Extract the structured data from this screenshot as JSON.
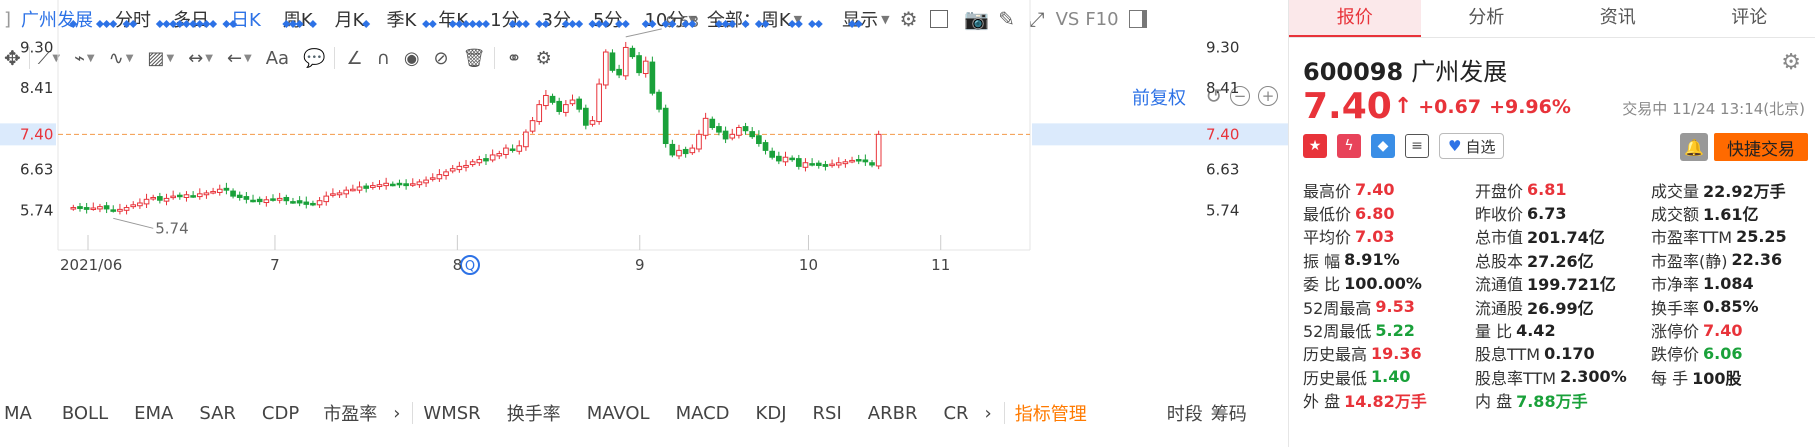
{
  "topbar": {
    "name": "广州发展",
    "periods": [
      "分时",
      "多日",
      "日K",
      "周K",
      "月K",
      "季K",
      "年K",
      "1分",
      "3分",
      "5分",
      "10分"
    ],
    "active_period": "日K",
    "range_select": "全部：周K",
    "display": "显示",
    "vs": "VS",
    "f10": "F10"
  },
  "toolbar2": {
    "text_tool": "Aa"
  },
  "chart": {
    "adjust_label": "前复权",
    "y_ticks": [
      "9.30",
      "8.41",
      "7.40",
      "6.63",
      "5.74"
    ],
    "x_ticks": [
      "2021/06",
      "7",
      "8",
      "9",
      "10",
      "11"
    ],
    "high_label": "9.53",
    "low_label": "5.74",
    "current_label": "7.40",
    "up_color": "#e8333a",
    "down_color": "#1aa13a",
    "marker_color": "#2d72e6",
    "event_icon": "Q"
  },
  "chart_data": {
    "type": "candlestick",
    "ylim": [
      5.2,
      9.9
    ],
    "current_price": 7.4,
    "period_high": 9.53,
    "period_low": 5.74,
    "x_tick_labels": [
      "2021/06",
      "7",
      "8",
      "9",
      "10",
      "11"
    ],
    "close_series": [
      5.8,
      5.78,
      5.76,
      5.79,
      5.82,
      5.77,
      5.74,
      5.76,
      5.8,
      5.86,
      5.9,
      5.98,
      6.02,
      5.96,
      6.0,
      6.05,
      6.04,
      6.08,
      6.06,
      6.1,
      6.12,
      6.15,
      6.2,
      6.18,
      6.05,
      6.02,
      5.98,
      5.96,
      5.93,
      5.97,
      5.98,
      6.0,
      5.95,
      5.93,
      5.9,
      5.87,
      5.88,
      5.95,
      6.05,
      6.1,
      6.12,
      6.18,
      6.2,
      6.25,
      6.22,
      6.28,
      6.3,
      6.33,
      6.31,
      6.3,
      6.28,
      6.32,
      6.36,
      6.4,
      6.45,
      6.52,
      6.58,
      6.65,
      6.7,
      6.72,
      6.8,
      6.85,
      6.82,
      6.95,
      6.98,
      7.1,
      7.05,
      7.15,
      7.45,
      7.7,
      8.05,
      8.25,
      8.1,
      7.9,
      8.05,
      8.15,
      7.95,
      7.6,
      7.7,
      8.5,
      9.2,
      8.8,
      8.7,
      9.3,
      9.1,
      8.75,
      9.0,
      8.3,
      7.95,
      7.2,
      6.95,
      7.05,
      6.98,
      7.1,
      7.4,
      7.75,
      7.55,
      7.45,
      7.3,
      7.4,
      7.55,
      7.48,
      7.35,
      7.2,
      7.05,
      6.9,
      6.82,
      6.9,
      6.85,
      6.7,
      6.78,
      6.75,
      6.72,
      6.7,
      6.75,
      6.78,
      6.8,
      6.83,
      6.82,
      6.8,
      6.73,
      7.4
    ]
  },
  "indicators": [
    "MA",
    "BOLL",
    "EMA",
    "SAR",
    "CDP",
    "市盈率",
    "WMSR",
    "换手率",
    "MAVOL",
    "MACD",
    "KDJ",
    "RSI",
    "ARBR",
    "CR"
  ],
  "indicator_mgmt": "指标管理",
  "bottom_right": [
    "时段",
    "筹码"
  ],
  "panel": {
    "tabs": [
      "报价",
      "分析",
      "资讯",
      "评论"
    ],
    "active_tab": "报价",
    "code": "600098",
    "name": "广州发展",
    "price": "7.40",
    "change": "+0.67",
    "change_pct": "+9.96%",
    "status": "交易中 11/24 13:14(北京)",
    "watch": "自选",
    "quick_trade": "快捷交易",
    "quotes": [
      [
        {
          "l": "最高价",
          "v": "7.40",
          "c": "red"
        },
        {
          "l": "开盘价",
          "v": "6.81",
          "c": "red"
        },
        {
          "l": "成交量",
          "v": "22.92万手",
          "c": ""
        }
      ],
      [
        {
          "l": "最低价",
          "v": "6.80",
          "c": "red"
        },
        {
          "l": "昨收价",
          "v": "6.73",
          "c": ""
        },
        {
          "l": "成交额",
          "v": "1.61亿",
          "c": ""
        }
      ],
      [
        {
          "l": "平均价",
          "v": "7.03",
          "c": "red"
        },
        {
          "l": "总市值",
          "v": "201.74亿",
          "c": ""
        },
        {
          "l": "市盈率TTM",
          "v": "25.25",
          "c": ""
        }
      ],
      [
        {
          "l": "振 幅",
          "v": "8.91%",
          "c": ""
        },
        {
          "l": "总股本",
          "v": "27.26亿",
          "c": ""
        },
        {
          "l": "市盈率(静)",
          "v": "22.36",
          "c": ""
        }
      ],
      [
        {
          "l": "委 比",
          "v": "100.00%",
          "c": ""
        },
        {
          "l": "流通值",
          "v": "199.721亿",
          "c": ""
        },
        {
          "l": "市净率",
          "v": "1.084",
          "c": ""
        }
      ],
      [
        {
          "l": "52周最高",
          "v": "9.53",
          "c": "red"
        },
        {
          "l": "流通股",
          "v": "26.99亿",
          "c": ""
        },
        {
          "l": "换手率",
          "v": "0.85%",
          "c": ""
        }
      ],
      [
        {
          "l": "52周最低",
          "v": "5.22",
          "c": "green"
        },
        {
          "l": "量 比",
          "v": "4.42",
          "c": ""
        },
        {
          "l": "涨停价",
          "v": "7.40",
          "c": "red"
        }
      ],
      [
        {
          "l": "历史最高",
          "v": "19.36",
          "c": "red"
        },
        {
          "l": "股息TTM",
          "v": "0.170",
          "c": ""
        },
        {
          "l": "跌停价",
          "v": "6.06",
          "c": "green"
        }
      ],
      [
        {
          "l": "历史最低",
          "v": "1.40",
          "c": "green"
        },
        {
          "l": "股息率TTM",
          "v": "2.300%",
          "c": ""
        },
        {
          "l": "每 手",
          "v": "100股",
          "c": ""
        }
      ],
      [
        {
          "l": "外 盘",
          "v": "14.82万手",
          "c": "red"
        },
        {
          "l": "内 盘",
          "v": "7.88万手",
          "c": "green"
        },
        {
          "l": "",
          "v": "",
          "c": ""
        }
      ]
    ]
  }
}
